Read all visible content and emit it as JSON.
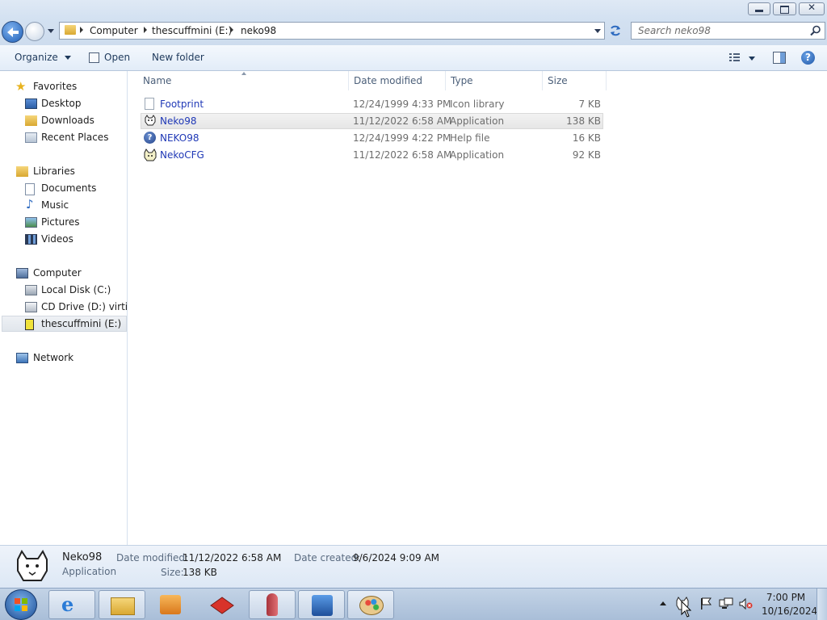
{
  "window": {
    "caption_buttons": [
      "minimize-icon",
      "restore-icon",
      "close-icon"
    ]
  },
  "address": {
    "crumbs": [
      "Computer",
      "thescuffmini (E:)",
      "neko98"
    ],
    "search_placeholder": "Search neko98"
  },
  "toolbar": {
    "organize_label": "Organize",
    "open_label": "Open",
    "new_folder_label": "New folder"
  },
  "nav": {
    "favorites": {
      "label": "Favorites",
      "items": [
        "Desktop",
        "Downloads",
        "Recent Places"
      ]
    },
    "libraries": {
      "label": "Libraries",
      "items": [
        "Documents",
        "Music",
        "Pictures",
        "Videos"
      ]
    },
    "computer": {
      "label": "Computer",
      "items": [
        "Local Disk (C:)",
        "CD Drive (D:) virtio-v",
        "thescuffmini (E:)"
      ]
    },
    "network": {
      "label": "Network"
    }
  },
  "columns": {
    "name": "Name",
    "date": "Date modified",
    "type": "Type",
    "size": "Size"
  },
  "files": [
    {
      "name": "Footprint",
      "date": "12/24/1999 4:33 PM",
      "type": "Icon library",
      "size": "7 KB",
      "icon": "document-icon"
    },
    {
      "name": "Neko98",
      "date": "11/12/2022 6:58 AM",
      "type": "Application",
      "size": "138 KB",
      "icon": "neko-cat-icon"
    },
    {
      "name": "NEKO98",
      "date": "12/24/1999 4:22 PM",
      "type": "Help file",
      "size": "16 KB",
      "icon": "help-icon"
    },
    {
      "name": "NekoCFG",
      "date": "11/12/2022 6:58 AM",
      "type": "Application",
      "size": "92 KB",
      "icon": "neko-config-icon"
    }
  ],
  "selected_file_index": 1,
  "details": {
    "name": "Neko98",
    "kind": "Application",
    "date_modified_label": "Date modified:",
    "date_modified": "11/12/2022 6:58 AM",
    "date_created_label": "Date created:",
    "date_created": "9/6/2024 9:09 AM",
    "size_label": "Size:",
    "size": "138 KB"
  },
  "taskbar": {
    "apps": [
      "internet-explorer-icon",
      "explorer-icon",
      "media-player-icon",
      "game-icon",
      "rocket-icon",
      "app-icon",
      "paint-icon"
    ],
    "time": "7:00 PM",
    "date": "10/16/2024"
  },
  "colors": {
    "link_blue": "#1f38b6",
    "meta_gray": "#6d6d6d",
    "accent": "#3b72c4"
  }
}
